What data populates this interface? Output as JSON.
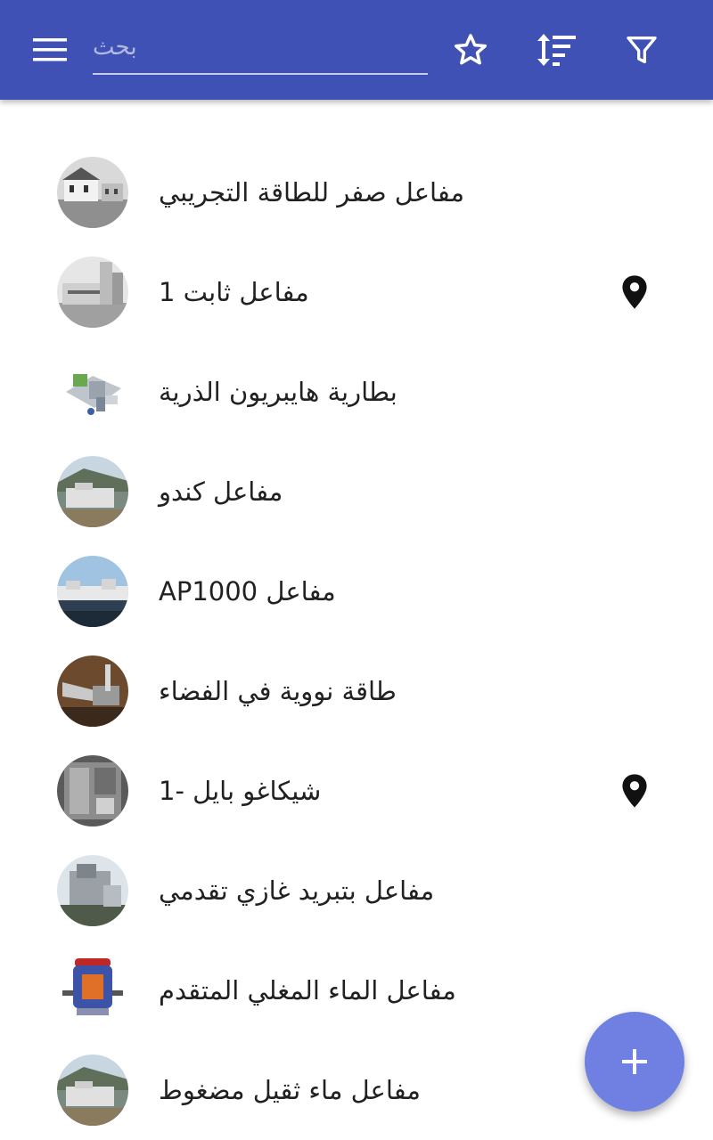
{
  "toolbar": {
    "menu_icon": "menu-icon",
    "search_placeholder": "بحث",
    "favorite_icon": "star-outline-icon",
    "sort_icon": "sort-icon",
    "filter_icon": "filter-icon",
    "bar_color": "#3f51b5"
  },
  "list": {
    "items": [
      {
        "label": "مفاعل صفر للطاقة التجريبي",
        "has_location": false
      },
      {
        "label": "مفاعل ثابت 1",
        "has_location": true
      },
      {
        "label": "بطارية هايبريون الذرية",
        "has_location": false
      },
      {
        "label": "مفاعل كندو",
        "has_location": false
      },
      {
        "label": "مفاعل AP1000",
        "has_location": false
      },
      {
        "label": "طاقة نووية في الفضاء",
        "has_location": false
      },
      {
        "label": "شيكاغو بايل -1",
        "has_location": true
      },
      {
        "label": "مفاعل بتبريد غازي تقدمي",
        "has_location": false
      },
      {
        "label": "مفاعل الماء المغلي المتقدم",
        "has_location": false
      },
      {
        "label": "مفاعل ماء ثقيل مضغوط",
        "has_location": false
      }
    ]
  },
  "fab": {
    "icon": "plus-icon",
    "color": "#6f7fe2"
  }
}
